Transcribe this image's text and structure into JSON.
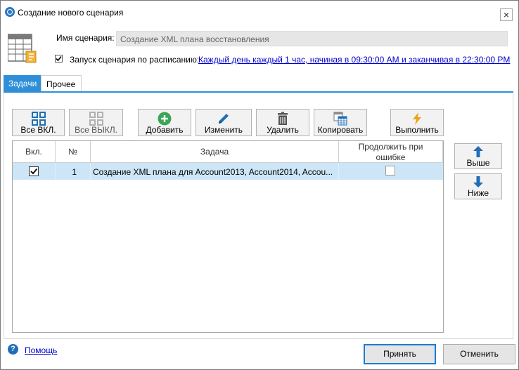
{
  "window": {
    "title": "Создание нового сценария",
    "close_glyph": "×",
    "icon": "app-icon"
  },
  "form": {
    "name_label": "Имя сценария:",
    "name_value": "Создание XML плана восстановления",
    "schedule_label": "Запуск сценария по расписанию:",
    "schedule_checked": true,
    "schedule_link": "Каждый день каждый 1 час, начиная в 09:30:00 AM и заканчивая в 22:30:00 PM"
  },
  "tabs": [
    {
      "label": "Задачи",
      "active": true
    },
    {
      "label": "Прочее",
      "active": false
    }
  ],
  "toolbar": {
    "all_on": "Все ВКЛ.",
    "all_off": "Все ВЫКЛ.",
    "add": "Добавить",
    "edit": "Изменить",
    "delete": "Удалить",
    "copy": "Копировать",
    "run": "Выполнить"
  },
  "table": {
    "headers": {
      "enabled": "Вкл.",
      "number": "№",
      "task": "Задача",
      "continue_on_error": "Продолжить при ошибке"
    },
    "rows": [
      {
        "enabled": true,
        "number": "1",
        "task": "Создание XML плана для Account2013, Account2014, Accou...",
        "continue_on_error": false
      }
    ]
  },
  "side": {
    "up": "Выше",
    "down": "Ниже"
  },
  "footer": {
    "help": "Помощь",
    "ok": "Принять",
    "cancel": "Отменить"
  },
  "colors": {
    "accent": "#2e8fd8",
    "selected_row": "#cde6f7",
    "link": "#0000cc",
    "add_green": "#3aa656",
    "run_orange": "#f0a21b"
  }
}
